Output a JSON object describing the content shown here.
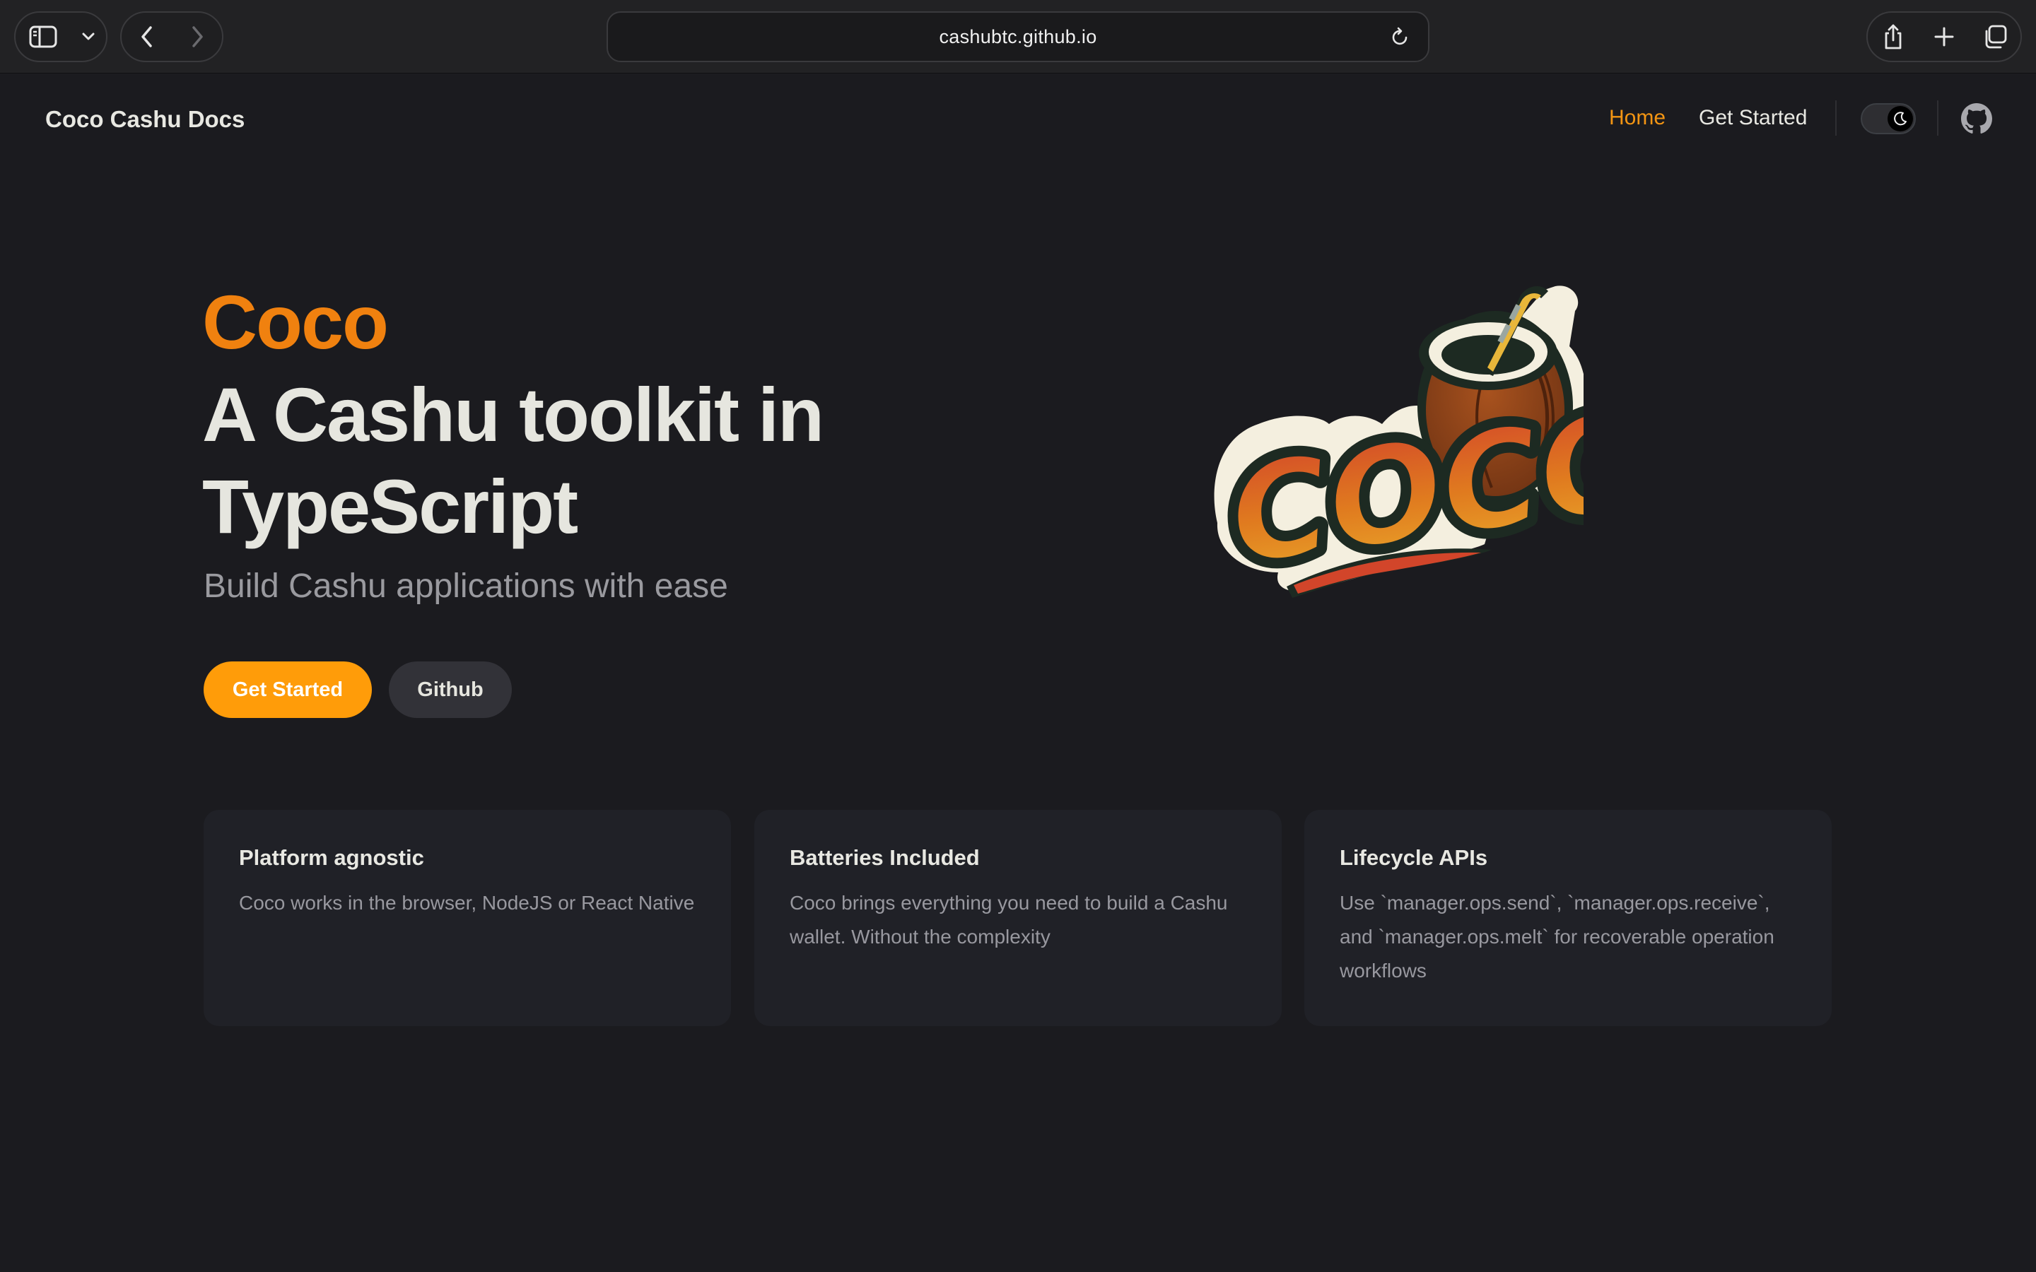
{
  "browser": {
    "url": "cashubtc.github.io"
  },
  "nav": {
    "title": "Coco Cashu Docs",
    "links": [
      {
        "label": "Home",
        "active": true
      },
      {
        "label": "Get Started",
        "active": false
      }
    ]
  },
  "hero": {
    "name": "Coco",
    "text": "A Cashu toolkit in TypeScript",
    "tagline": "Build Cashu applications with ease",
    "actions": [
      {
        "label": "Get Started",
        "theme": "brand"
      },
      {
        "label": "Github",
        "theme": "alt"
      }
    ],
    "logo_text": "COCO"
  },
  "features": [
    {
      "title": "Platform agnostic",
      "details": "Coco works in the browser, NodeJS or React Native"
    },
    {
      "title": "Batteries Included",
      "details": "Coco brings everything you need to build a Cashu wallet. Without the complexity"
    },
    {
      "title": "Lifecycle APIs",
      "details": "Use `manager.ops.send`, `manager.ops.receive`, and `manager.ops.melt` for recoverable operation workflows"
    }
  ],
  "colors": {
    "background": "#1b1b1f",
    "brand": "#ff9c09",
    "brand_text": "#f0810f",
    "card": "#202127"
  },
  "icons": [
    "sidebar-icon",
    "chevron-down-icon",
    "back-icon",
    "forward-icon",
    "reload-icon",
    "share-icon",
    "plus-icon",
    "tabs-icon",
    "moon-icon",
    "github-icon"
  ]
}
